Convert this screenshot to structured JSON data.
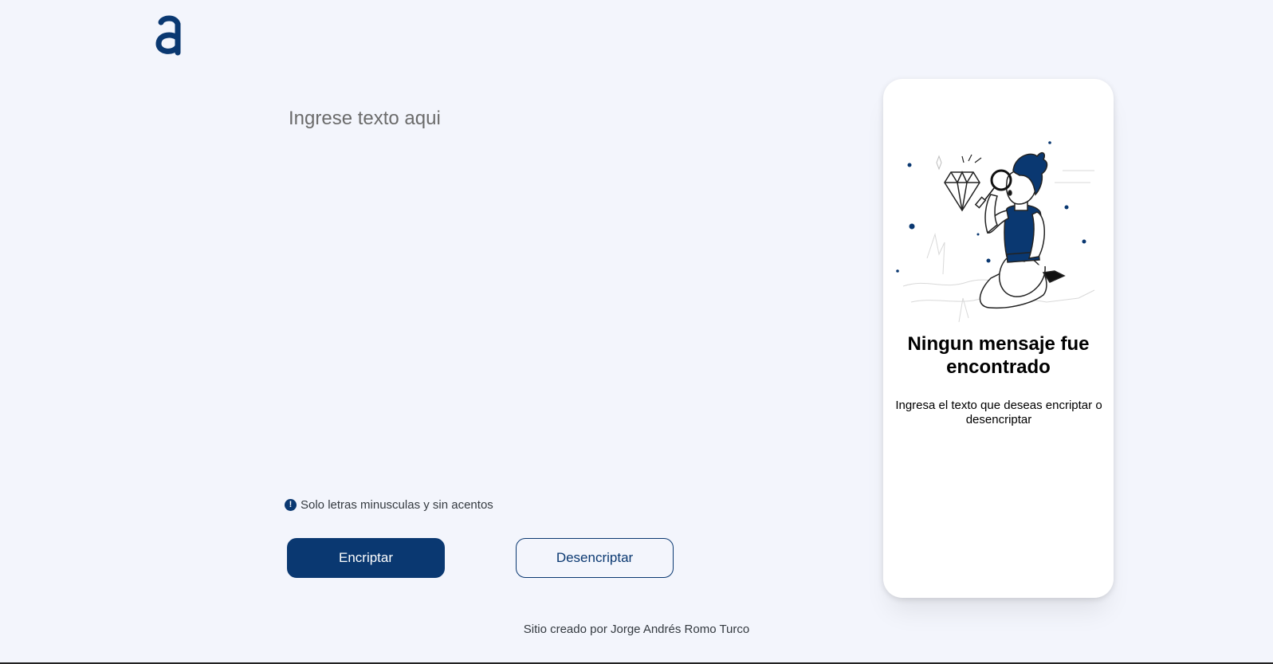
{
  "header": {
    "logo_icon": "alura-a-logo-icon"
  },
  "editor": {
    "placeholder": "Ingrese texto aqui",
    "hint_icon": "exclamation-circle-icon",
    "hint_text": "Solo letras minusculas y sin acentos"
  },
  "actions": {
    "encrypt_label": "Encriptar",
    "decrypt_label": "Desencriptar"
  },
  "output_panel": {
    "illustration": "person-with-magnifying-glass-illustration",
    "title": "Ningun mensaje fue encontrado",
    "message": "Ingresa el texto que deseas encriptar o desencriptar"
  },
  "footer": {
    "credit": "Sitio creado por Jorge Andrés Romo Turco"
  },
  "colors": {
    "background": "#f3f5fc",
    "primary": "#0a3871",
    "card": "#ffffff"
  }
}
